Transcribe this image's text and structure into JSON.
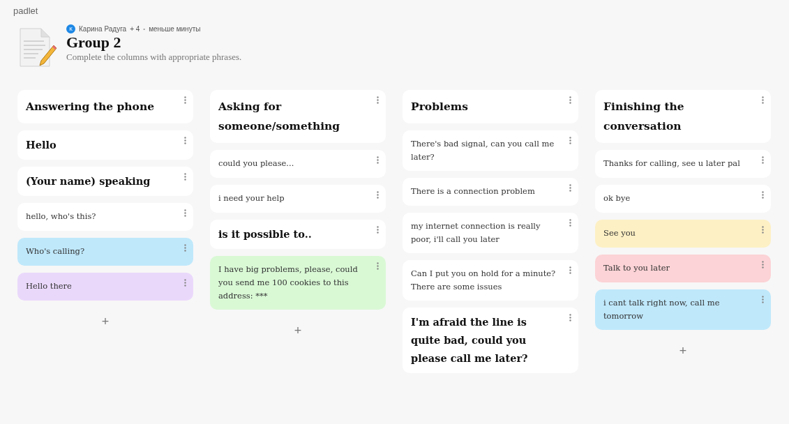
{
  "brand": "padlet",
  "header": {
    "avatar_letter": "К",
    "author": "Карина Радуга",
    "contributors": "+ 4",
    "separator": "•",
    "time": "меньше минуты",
    "title": "Group 2",
    "description": "Complete the columns with appropriate phrases."
  },
  "columns": [
    {
      "title": "Answering the phone",
      "add": "+",
      "posts": [
        {
          "text": "Hello",
          "kind": "heading",
          "color": "#ffffff"
        },
        {
          "text": "(Your name) speaking",
          "kind": "heading",
          "color": "#ffffff"
        },
        {
          "text": "hello, who's this?",
          "kind": "plain",
          "color": "#ffffff"
        },
        {
          "text": "Who's calling?",
          "kind": "plain",
          "color": "#bfe8fb"
        },
        {
          "text": "Hello there",
          "kind": "plain",
          "color": "#ead8fb"
        }
      ]
    },
    {
      "title": "Asking for someone/something",
      "add": "+",
      "posts": [
        {
          "text": "could you please...",
          "kind": "plain",
          "color": "#ffffff"
        },
        {
          "text": "i need your help",
          "kind": "plain",
          "color": "#ffffff"
        },
        {
          "text": "is it possible to..",
          "kind": "heading",
          "color": "#ffffff"
        },
        {
          "text": "I have big problems, please, could you send me 100 cookies to this address: ***",
          "kind": "plain",
          "color": "#d9f9d5"
        }
      ]
    },
    {
      "title": "Problems",
      "posts": [
        {
          "text": "There's bad signal, can you call me later?",
          "kind": "plain",
          "color": "#ffffff"
        },
        {
          "text": "There is a connection problem",
          "kind": "plain",
          "color": "#ffffff"
        },
        {
          "text": "my internet connection is really poor, i'll call you later",
          "kind": "plain",
          "color": "#ffffff"
        },
        {
          "text": "Can I put you on hold for a minute? There are some issues",
          "kind": "plain",
          "color": "#ffffff"
        },
        {
          "text": "I'm afraid the line is quite bad, could you please call me later?",
          "kind": "heading",
          "color": "#ffffff"
        }
      ]
    },
    {
      "title": "Finishing the conversation",
      "add": "+",
      "posts": [
        {
          "text": "Thanks for calling, see u later pal",
          "kind": "plain",
          "color": "#ffffff"
        },
        {
          "text": "ok bye",
          "kind": "plain",
          "color": "#ffffff"
        },
        {
          "text": "See you",
          "kind": "plain",
          "color": "#fdf0c4"
        },
        {
          "text": "Talk to you later",
          "kind": "plain",
          "color": "#fcd3d6"
        },
        {
          "text": "i cant talk right now, call me tomorrow",
          "kind": "plain",
          "color": "#bfe8fb"
        }
      ]
    }
  ]
}
